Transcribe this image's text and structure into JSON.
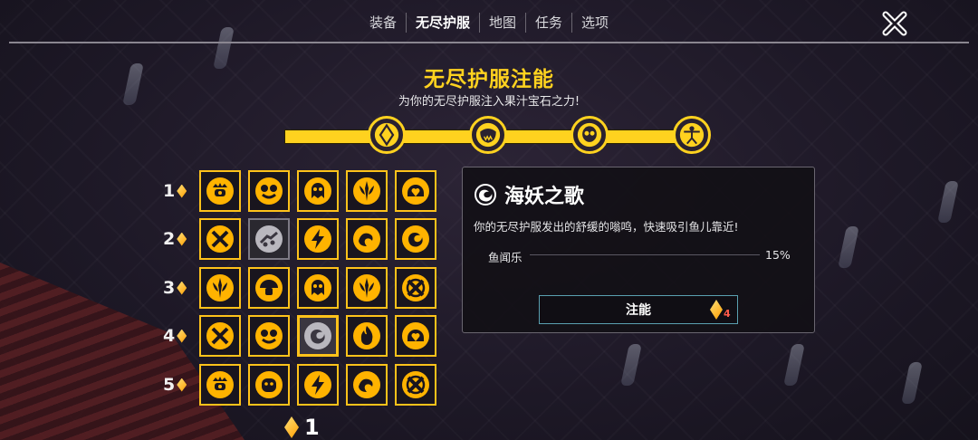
{
  "nav": {
    "tabs": [
      {
        "label": "装备"
      },
      {
        "label": "无尽护服"
      },
      {
        "label": "地图"
      },
      {
        "label": "任务"
      },
      {
        "label": "选项"
      }
    ],
    "active_tab": "无尽护服"
  },
  "header": {
    "title": "无尽护服注能",
    "subtitle": "为你的无尽护服注入果汁宝石之力!"
  },
  "progress_nodes": [
    {
      "icon": "crystal-icon"
    },
    {
      "icon": "fanged-mask-icon"
    },
    {
      "icon": "skull-mask-icon"
    },
    {
      "icon": "vitruvian-figure-icon"
    }
  ],
  "grid": {
    "row_labels": [
      "1",
      "2",
      "3",
      "4",
      "5"
    ],
    "rows": [
      [
        "crown-bug-icon",
        "frog-face-icon",
        "ghost-orb-icon",
        "fleur-trident-icon",
        "helmet-heart-icon"
      ],
      [
        "cross-tools-icon",
        "fish-school-icon",
        "lightning-bolt-icon",
        "wave-swirl-icon",
        "dragon-coil-icon"
      ],
      [
        "fleur-spark-icon",
        "mushroom-face-icon",
        "ghost-orb-icon",
        "fleur-trident-icon",
        "target-cross-icon"
      ],
      [
        "cross-tools-icon",
        "frog-face-icon",
        "siren-swirl-icon",
        "flame-face-icon",
        "helmet-heart-icon"
      ],
      [
        "crown-bug-icon",
        "bulldog-face-icon",
        "lightning-bolt-icon",
        "wave-swirl-icon",
        "target-cross-icon"
      ]
    ],
    "grey_cell": [
      1,
      1
    ],
    "selected_cell": [
      3,
      2
    ]
  },
  "gem_count": "1",
  "detail": {
    "icon": "siren-swirl-icon",
    "title": "海妖之歌",
    "description": "你的无尽护服发出的舒缓的嗡鸣，快速吸引鱼儿靠近!",
    "stat_label": "鱼闻乐",
    "stat_value": "15%",
    "button_label": "注能",
    "cost": "4"
  },
  "colors": {
    "accent": "#ffd21f",
    "cost_red": "#ff5a4a",
    "button_border": "#5aa0b0"
  }
}
